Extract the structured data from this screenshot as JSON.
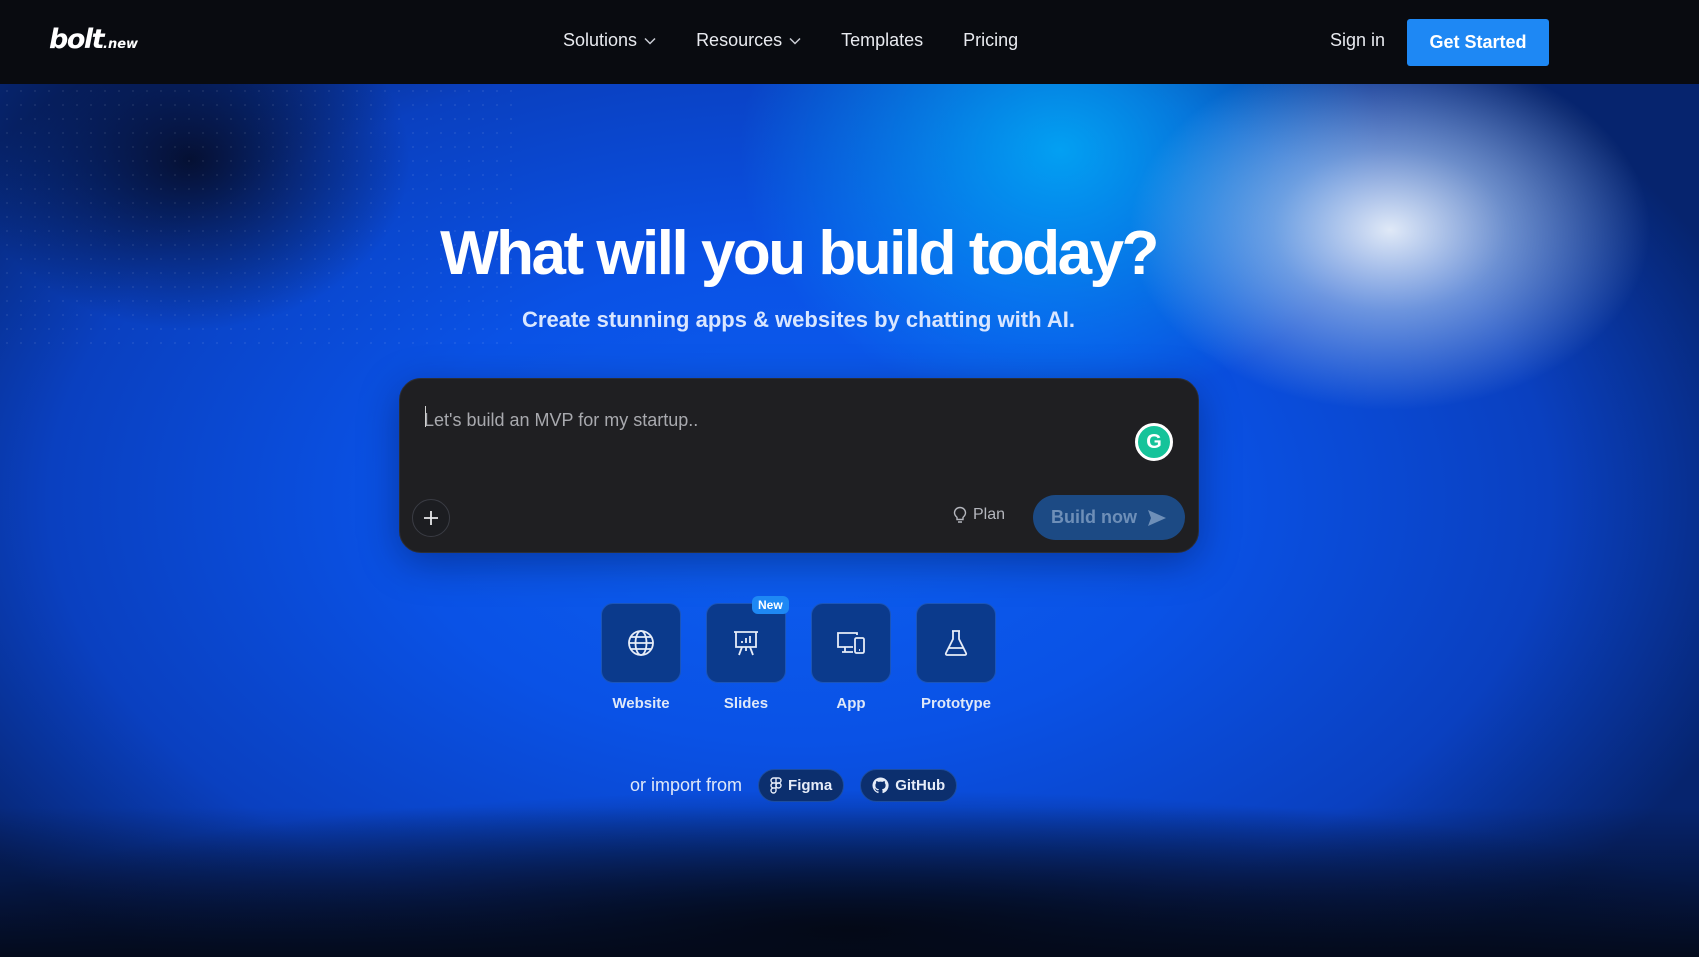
{
  "header": {
    "logo_main": "bolt",
    "logo_suffix": ".new",
    "nav": [
      {
        "label": "Solutions",
        "has_dropdown": true
      },
      {
        "label": "Resources",
        "has_dropdown": true
      },
      {
        "label": "Templates",
        "has_dropdown": false
      },
      {
        "label": "Pricing",
        "has_dropdown": false
      }
    ],
    "sign_in": "Sign in",
    "get_started": "Get Started"
  },
  "hero": {
    "headline": "What will you build today?",
    "subhead": "Create stunning apps & websites by chatting with AI."
  },
  "prompt": {
    "placeholder": "Let's build an MVP for my startup..",
    "value": "",
    "plan_label": "Plan",
    "build_label": "Build now",
    "grammarly_letter": "G"
  },
  "quick_actions": [
    {
      "label": "Website",
      "icon": "globe-icon"
    },
    {
      "label": "Slides",
      "icon": "presentation-icon",
      "badge": "New"
    },
    {
      "label": "App",
      "icon": "devices-icon"
    },
    {
      "label": "Prototype",
      "icon": "flask-icon"
    }
  ],
  "import": {
    "text": "or import from",
    "sources": [
      {
        "label": "Figma",
        "icon": "figma-icon"
      },
      {
        "label": "GitHub",
        "icon": "github-icon"
      }
    ]
  },
  "colors": {
    "accent": "#1e88f4",
    "header_bg": "#090b10",
    "prompt_bg": "#1f1f22",
    "tile_bg": "#0b3a8c"
  }
}
